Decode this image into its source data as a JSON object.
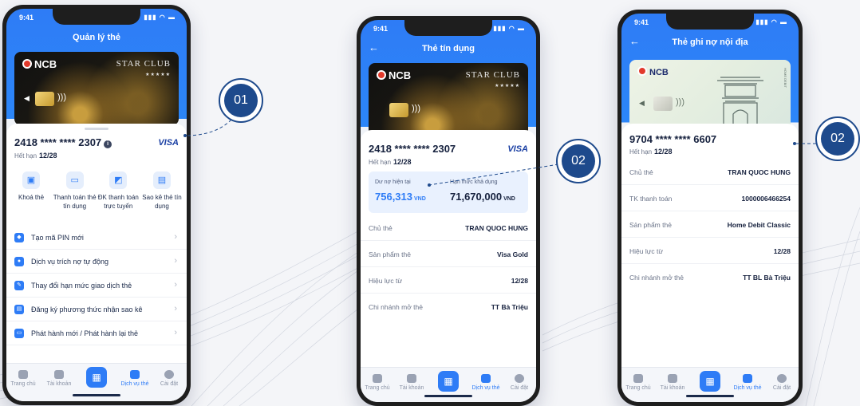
{
  "colors": {
    "primary": "#2e7cf6",
    "navy": "#1e4a8c",
    "text": "#16213e"
  },
  "status": {
    "time": "9:41"
  },
  "bank": {
    "logo": "NCB",
    "card_tier": "STAR CLUB",
    "card_stars": "★★★★★"
  },
  "phone1": {
    "title": "Quản lý thẻ",
    "card_number": "2418 **** **** 2307",
    "card_brand": "VISA",
    "expiry_label": "Hết hạn",
    "expiry_value": "12/28",
    "actions": [
      {
        "icon": "lock-icon",
        "label": "Khoá thẻ"
      },
      {
        "icon": "credit-card-icon",
        "label": "Thanh toán thẻ tín dụng"
      },
      {
        "icon": "online-payment-icon",
        "label": "ĐK thanh toán trực tuyến"
      },
      {
        "icon": "statement-icon",
        "label": "Sao kê thẻ tín dụng"
      }
    ],
    "menu": [
      {
        "icon": "shield-icon",
        "label": "Tạo mã PIN mới"
      },
      {
        "icon": "money-bag-icon",
        "label": "Dịch vụ trích nợ tự động"
      },
      {
        "icon": "edit-icon",
        "label": "Thay đổi hạn mức giao dịch thẻ"
      },
      {
        "icon": "document-icon",
        "label": "Đăng ký phương thức nhận sao kê"
      },
      {
        "icon": "card-reissue-icon",
        "label": "Phát hành mới / Phát hành lại thẻ"
      }
    ]
  },
  "phone2": {
    "title": "Thẻ tín dụng",
    "card_number": "2418 **** **** 2307",
    "card_brand": "VISA",
    "expiry_label": "Hết hạn",
    "expiry_value": "12/28",
    "balance": {
      "current_label": "Dư nợ hiện tại",
      "current_value": "756,313",
      "limit_label": "Hạn mức khả dụng",
      "limit_value": "71,670,000",
      "currency": "VND"
    },
    "rows": [
      {
        "key": "Chủ thẻ",
        "value": "TRAN QUOC HUNG"
      },
      {
        "key": "Sản phẩm thẻ",
        "value": "Visa Gold"
      },
      {
        "key": "Hiệu lực từ",
        "value": "12/28"
      },
      {
        "key": "Chi nhánh mở thẻ",
        "value": "TT Bà Triệu"
      }
    ]
  },
  "phone3": {
    "title": "Thẻ ghi nợ nội địa",
    "card_number": "9704 **** **** 6607",
    "expiry_label": "Hết hạn",
    "expiry_value": "12/28",
    "card_side_label": "HOME DEBIT",
    "rows": [
      {
        "key": "Chủ thẻ",
        "value": "TRAN QUOC HUNG"
      },
      {
        "key": "TK thanh toán",
        "value": "1000006466254"
      },
      {
        "key": "Sản phẩm thẻ",
        "value": "Home Debit Classic"
      },
      {
        "key": "Hiệu lực từ",
        "value": "12/28"
      },
      {
        "key": "Chi nhánh mở thẻ",
        "value": "TT BL Bà Triệu"
      }
    ]
  },
  "tabbar": {
    "tabs": [
      {
        "icon": "home-icon",
        "label": "Trang chủ"
      },
      {
        "icon": "wallet-icon",
        "label": "Tài khoản"
      },
      {
        "icon": "qr-icon",
        "label": ""
      },
      {
        "icon": "card-service-icon",
        "label": "Dịch vụ thẻ"
      },
      {
        "icon": "settings-icon",
        "label": "Cài đặt"
      }
    ],
    "active_label": "Dịch vụ thẻ"
  },
  "callouts": [
    "01",
    "02",
    "02"
  ]
}
